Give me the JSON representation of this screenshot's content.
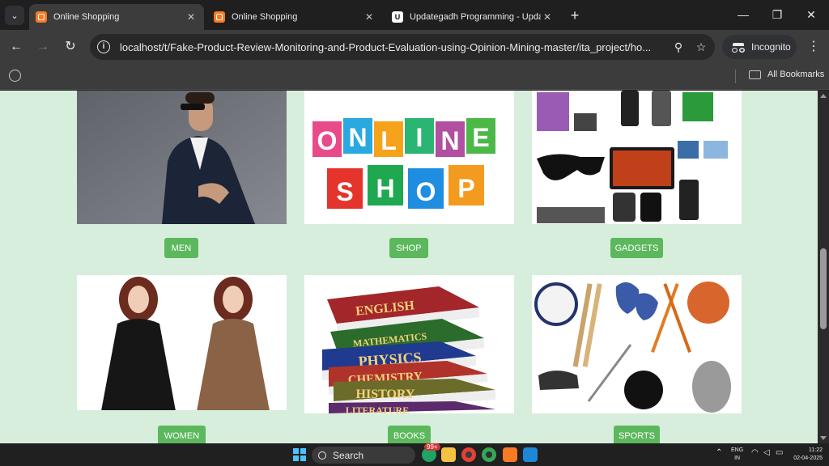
{
  "browser": {
    "tabs": [
      {
        "title": "Online Shopping",
        "active": true
      },
      {
        "title": "Online Shopping",
        "active": false
      },
      {
        "title": "Updategadh Programming - Upda",
        "active": false
      }
    ],
    "url": "localhost/t/Fake-Product-Review-Monitoring-and-Product-Evaluation-using-Opinion-Mining-master/ita_project/ho...",
    "incognito_label": "Incognito",
    "bookmarks_label": "All Bookmarks"
  },
  "categories": [
    {
      "label": "MEN",
      "image": "man-in-suit"
    },
    {
      "label": "SHOP",
      "image": "online-shop-bags"
    },
    {
      "label": "GADGETS",
      "image": "gadgets-collection"
    },
    {
      "label": "WOMEN",
      "image": "women-dresses"
    },
    {
      "label": "BOOKS",
      "image": "book-stack"
    },
    {
      "label": "SPORTS",
      "image": "sports-equipment"
    }
  ],
  "shop_letters": {
    "line1": "ONLINE",
    "line2": "SHOP"
  },
  "book_titles": [
    "ENGLISH",
    "MATHEMATICS",
    "PHYSICS",
    "CHEMISTRY",
    "HISTORY",
    "LITERATURE"
  ],
  "taskbar": {
    "search_label": "Search",
    "badge": "99+",
    "lang_line1": "ENG",
    "lang_line2": "IN",
    "time": "11:22",
    "date": "02-04-2025"
  },
  "colors": {
    "page_bg": "#d8eedd",
    "button_green": "#5cb85c"
  }
}
